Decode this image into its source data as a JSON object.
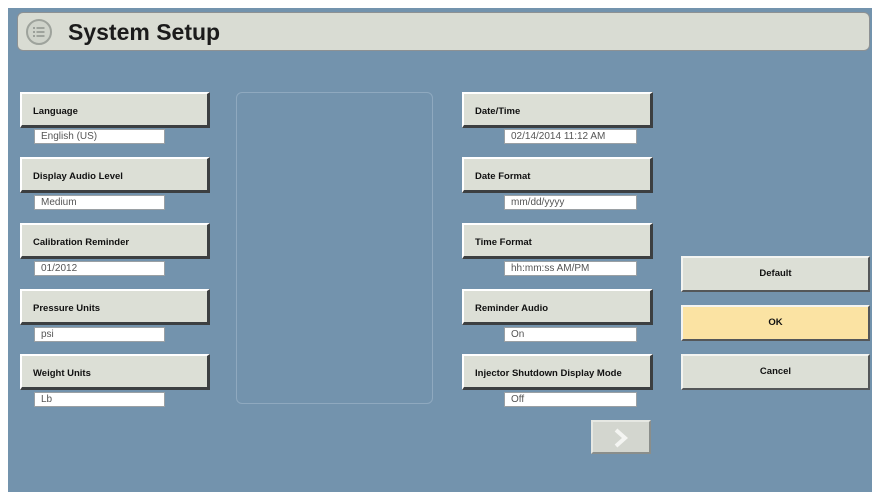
{
  "header": {
    "title": "System Setup",
    "menu_icon": "list-menu-icon"
  },
  "left_settings": [
    {
      "label": "Language",
      "value": "English (US)"
    },
    {
      "label": "Display Audio Level",
      "value": "Medium"
    },
    {
      "label": "Calibration Reminder",
      "value": "01/2012"
    },
    {
      "label": "Pressure Units",
      "value": "psi"
    },
    {
      "label": "Weight Units",
      "value": "Lb"
    }
  ],
  "right_settings": [
    {
      "label": "Date/Time",
      "value": "02/14/2014 11:12 AM"
    },
    {
      "label": "Date Format",
      "value": "mm/dd/yyyy"
    },
    {
      "label": "Time Format",
      "value": "hh:mm:ss AM/PM"
    },
    {
      "label": "Reminder Audio",
      "value": "On"
    },
    {
      "label": "Injector Shutdown Display Mode",
      "value": "Off"
    }
  ],
  "actions": {
    "default_label": "Default",
    "ok_label": "OK",
    "cancel_label": "Cancel"
  },
  "next_icon": "chevron-right-icon",
  "colors": {
    "background": "#7393ad",
    "ok_highlight": "#fbe3a3",
    "button": "#dcdfd6"
  }
}
